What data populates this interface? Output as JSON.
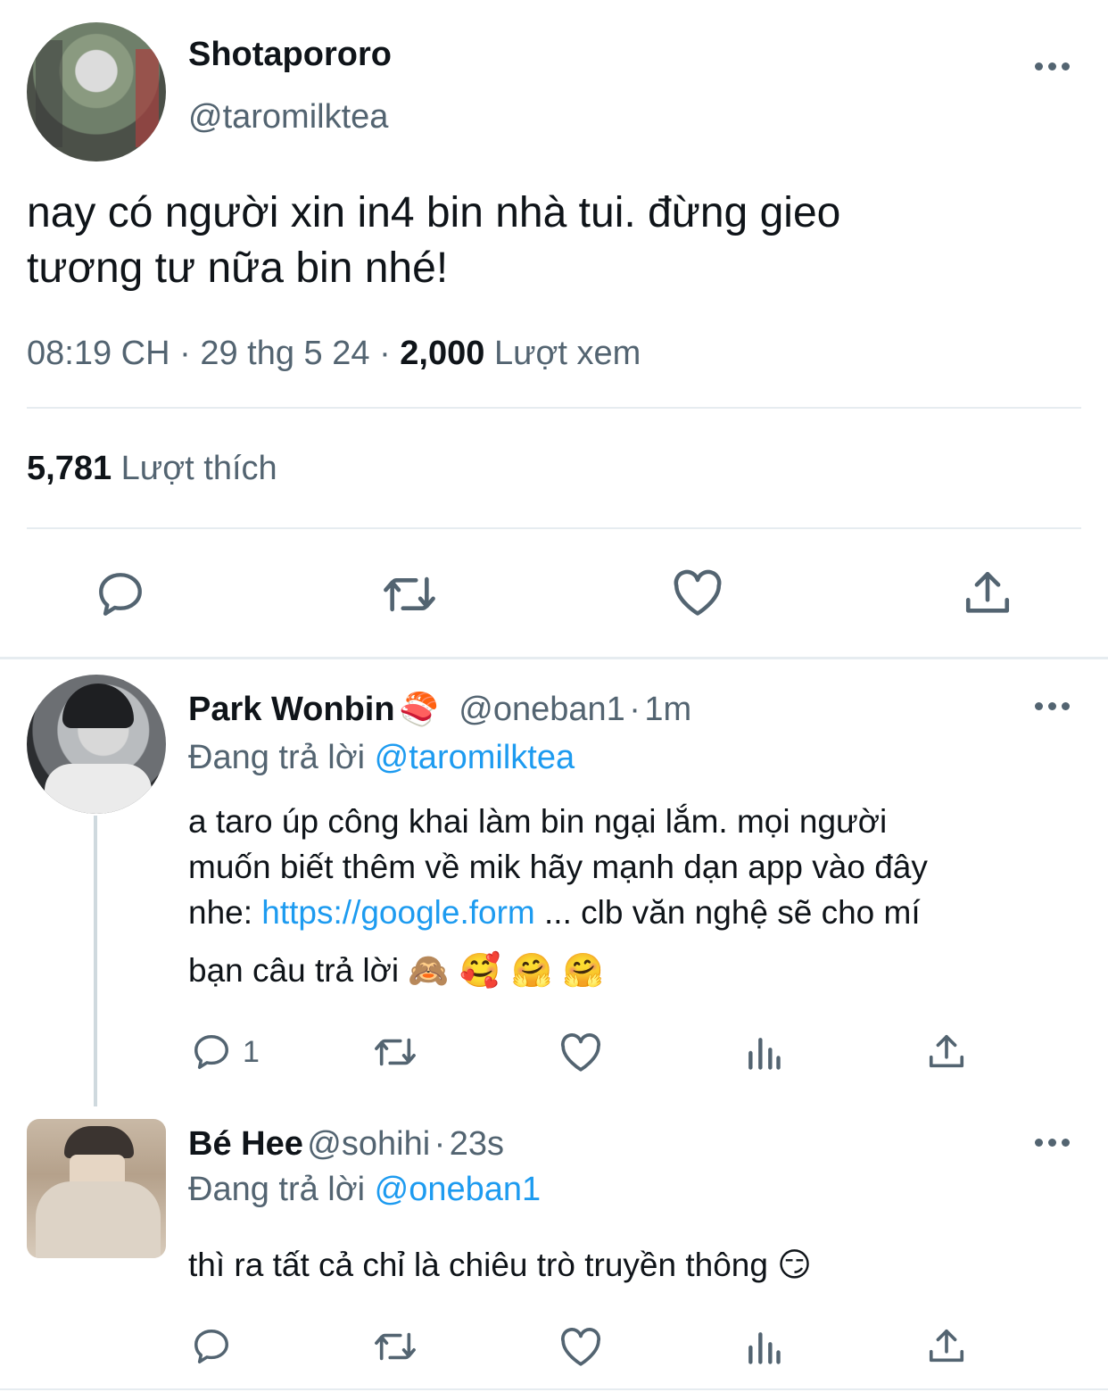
{
  "main_tweet": {
    "display_name": "Shotapororo",
    "handle": "@taromilktea",
    "text_line1": "nay có người xin in4 bin nhà tui. đừng gieo",
    "text_line2": "tương tư nữa bin nhé!",
    "time": "08:19 CH",
    "separator": "·",
    "date": "29 thg 5 24",
    "views_count": "2,000",
    "views_label": "Lượt xem",
    "likes_count": "5,781",
    "likes_label": "Lượt thích"
  },
  "reply1": {
    "display_name": "Park Wonbin",
    "name_emoji": "🍣",
    "handle": "@oneban1",
    "time": "1m",
    "replying_to_label": "Đang trả lời",
    "replying_to_handle": "@taromilktea",
    "line1": "a taro úp công khai làm bin ngại lắm. mọi người",
    "line2": "muốn biết thêm về mik hãy mạnh dạn app vào đây",
    "line3_prefix": "nhe: ",
    "link": "https://google.form",
    "line3_suffix": " ... clb văn nghệ sẽ cho mí",
    "line4": "bạn câu trả lời",
    "line4_emojis": "🙈 🥰 🤗 🤗",
    "reply_count": "1"
  },
  "reply2": {
    "display_name": "Bé Hee",
    "handle": "@sohihi",
    "time": "23s",
    "replying_to_label": "Đang trả lời",
    "replying_to_handle": "@oneban1",
    "text": "thì ra tất cả chỉ là chiêu trò truyền thông",
    "text_emoji": "😏"
  },
  "colors": {
    "text_primary": "#0f1419",
    "text_secondary": "#536471",
    "link": "#1d9bf0",
    "divider": "#e6ecf0"
  },
  "icons": [
    "more-icon",
    "reply-icon",
    "retweet-icon",
    "like-icon",
    "share-icon",
    "views-icon"
  ]
}
